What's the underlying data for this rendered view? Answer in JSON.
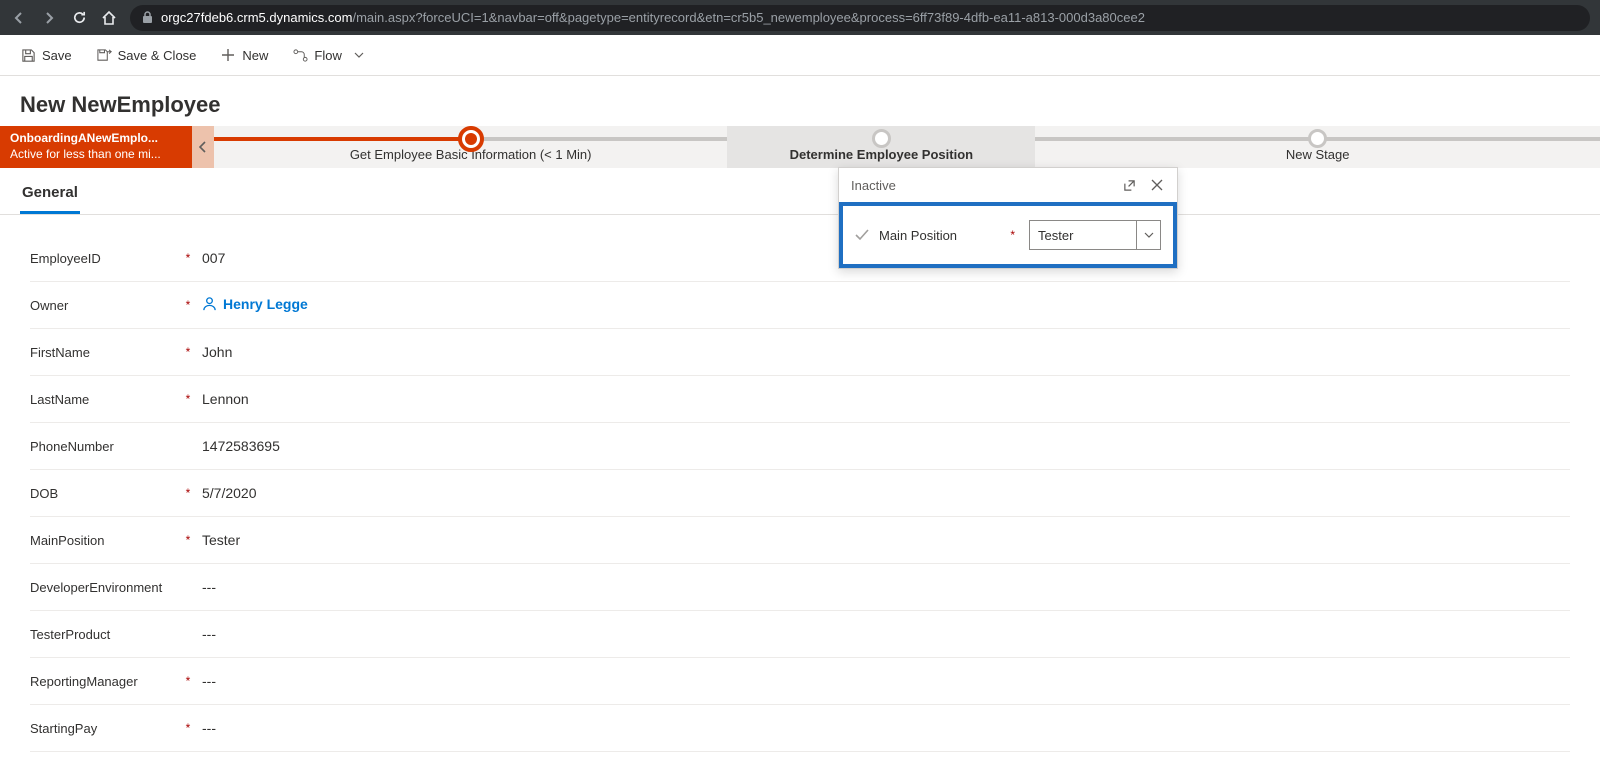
{
  "browser": {
    "url_domain": "orgc27fdeb6.crm5.dynamics.com",
    "url_path": "/main.aspx?forceUCI=1&navbar=off&pagetype=entityrecord&etn=cr5b5_newemployee&process=6ff73f89-4dfb-ea11-a813-000d3a80cee2"
  },
  "commands": {
    "save": "Save",
    "save_close": "Save & Close",
    "new": "New",
    "flow": "Flow"
  },
  "page_title": "New NewEmployee",
  "process": {
    "name": "OnboardingANewEmplo...",
    "status": "Active for less than one mi...",
    "stages": [
      {
        "label": "Get Employee Basic Information  (< 1 Min)",
        "state": "active"
      },
      {
        "label": "Determine Employee Position",
        "state": "selected"
      },
      {
        "label": "New Stage",
        "state": "pending"
      }
    ]
  },
  "tabs": {
    "general": "General"
  },
  "form": {
    "fields": [
      {
        "label": "EmployeeID",
        "required": true,
        "value": "007"
      },
      {
        "label": "Owner",
        "required": true,
        "value": "Henry Legge",
        "type": "owner"
      },
      {
        "label": "FirstName",
        "required": true,
        "value": "John"
      },
      {
        "label": "LastName",
        "required": true,
        "value": "Lennon"
      },
      {
        "label": "PhoneNumber",
        "required": false,
        "value": "1472583695"
      },
      {
        "label": "DOB",
        "required": true,
        "value": "5/7/2020"
      },
      {
        "label": "MainPosition",
        "required": true,
        "value": "Tester"
      },
      {
        "label": "DeveloperEnvironment",
        "required": false,
        "value": "---"
      },
      {
        "label": "TesterProduct",
        "required": false,
        "value": "---"
      },
      {
        "label": "ReportingManager",
        "required": true,
        "value": "---"
      },
      {
        "label": "StartingPay",
        "required": true,
        "value": "---"
      }
    ]
  },
  "flyout": {
    "status": "Inactive",
    "field_label": "Main Position",
    "field_value": "Tester"
  }
}
